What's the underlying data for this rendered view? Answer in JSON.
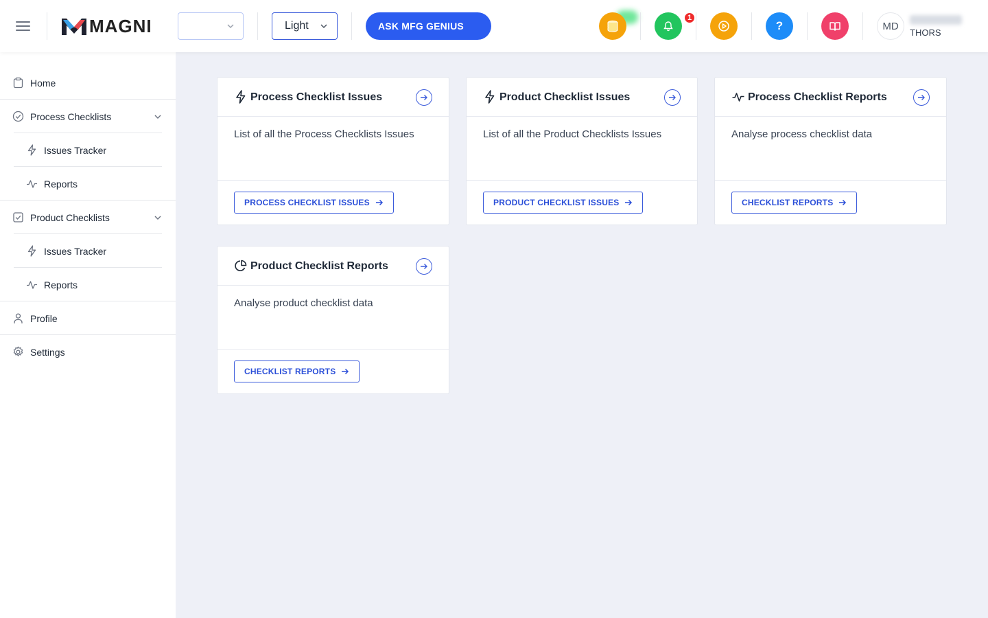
{
  "header": {
    "logo_text": "MAGNI",
    "org_select_value": "",
    "theme_select_value": "Light",
    "ask_button_label": "ASK MFG GENIUS",
    "notification_count": "1",
    "help_label": "?",
    "avatar_initials": "MD",
    "user_company": "THORS",
    "icons": [
      "menu-icon",
      "coins-icon",
      "bell-icon",
      "play-icon",
      "help-icon",
      "book-icon"
    ],
    "colors": {
      "primary": "#2b5cf0",
      "coins": "#f5a30a",
      "bell": "#22c55e",
      "play": "#f5a30a",
      "help": "#1d8cf8",
      "book": "#f0406a",
      "badge": "#ef2b2b"
    }
  },
  "sidebar": {
    "items": [
      {
        "label": "Home",
        "icon": "clipboard-icon"
      },
      {
        "label": "Process Checklists",
        "icon": "check-circle-icon",
        "expanded": true
      },
      {
        "label": "Issues Tracker",
        "icon": "bolt-icon"
      },
      {
        "label": "Reports",
        "icon": "activity-icon"
      },
      {
        "label": "Product Checklists",
        "icon": "check-square-icon",
        "expanded": true
      },
      {
        "label": "Issues Tracker",
        "icon": "bolt-icon"
      },
      {
        "label": "Reports",
        "icon": "activity-icon"
      },
      {
        "label": "Profile",
        "icon": "user-icon"
      },
      {
        "label": "Settings",
        "icon": "gear-icon"
      }
    ]
  },
  "cards": [
    {
      "title": "Process Checklist Issues",
      "icon": "bolt-icon",
      "description": "List of all the Process Checklists Issues",
      "button": "PROCESS CHECKLIST ISSUES"
    },
    {
      "title": "Product Checklist Issues",
      "icon": "bolt-icon",
      "description": "List of all the Product Checklists Issues",
      "button": "PRODUCT CHECKLIST ISSUES"
    },
    {
      "title": "Process Checklist Reports",
      "icon": "activity-icon",
      "description": "Analyse process checklist data",
      "button": "CHECKLIST REPORTS"
    },
    {
      "title": "Product Checklist Reports",
      "icon": "pie-chart-icon",
      "description": "Analyse product checklist data",
      "button": "CHECKLIST REPORTS"
    }
  ]
}
